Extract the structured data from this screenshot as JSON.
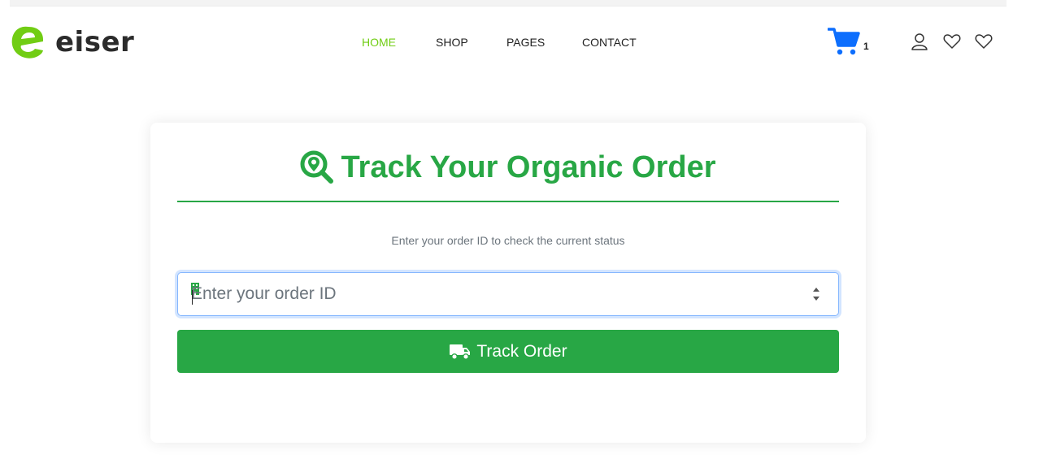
{
  "brand": {
    "name": "eiser",
    "accent": "#71cd14"
  },
  "nav": {
    "items": [
      {
        "label": "HOME",
        "active": true
      },
      {
        "label": "SHOP",
        "active": false
      },
      {
        "label": "PAGES",
        "active": false
      },
      {
        "label": "CONTACT",
        "active": false
      }
    ]
  },
  "header_icons": {
    "cart": {
      "icon": "cart-icon",
      "count": "1",
      "color": "#0d6efd"
    },
    "account": {
      "icon": "user-icon"
    },
    "wishlist": {
      "icon": "heart-icon"
    },
    "favorites": {
      "icon": "heart-icon"
    }
  },
  "tracker": {
    "title": "Track Your Organic Order",
    "title_icon": "search-location-icon",
    "subtitle": "Enter your order ID to check the current status",
    "input": {
      "placeholder": "Enter your order ID",
      "value": "",
      "icon": "building-icon"
    },
    "button": {
      "label": "Track Order",
      "icon": "truck-icon"
    },
    "accent": "#28a745"
  }
}
